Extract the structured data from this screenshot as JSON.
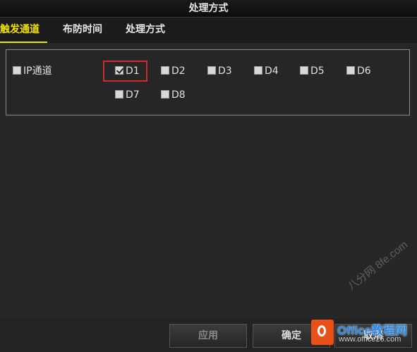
{
  "window": {
    "title": "处理方式"
  },
  "tabs": [
    {
      "label": "触发通道",
      "active": true
    },
    {
      "label": "布防时间",
      "active": false
    },
    {
      "label": "处理方式",
      "active": false
    }
  ],
  "channels": {
    "ip_channel": {
      "label": "IP通道",
      "checked": false
    },
    "items": [
      {
        "label": "D1",
        "checked": true
      },
      {
        "label": "D2",
        "checked": false
      },
      {
        "label": "D3",
        "checked": false
      },
      {
        "label": "D4",
        "checked": false
      },
      {
        "label": "D5",
        "checked": false
      },
      {
        "label": "D6",
        "checked": false
      },
      {
        "label": "D7",
        "checked": false
      },
      {
        "label": "D8",
        "checked": false
      }
    ]
  },
  "buttons": {
    "apply": "应用",
    "ok": "确定",
    "cancel": "取消"
  },
  "watermark": {
    "brand": "Office教程网",
    "url": "www.office26.com",
    "diagonal": "八分网 8fe.com"
  },
  "colors": {
    "active_tab": "#f2e200",
    "highlight": "#d22a2a",
    "background": "#272727"
  }
}
